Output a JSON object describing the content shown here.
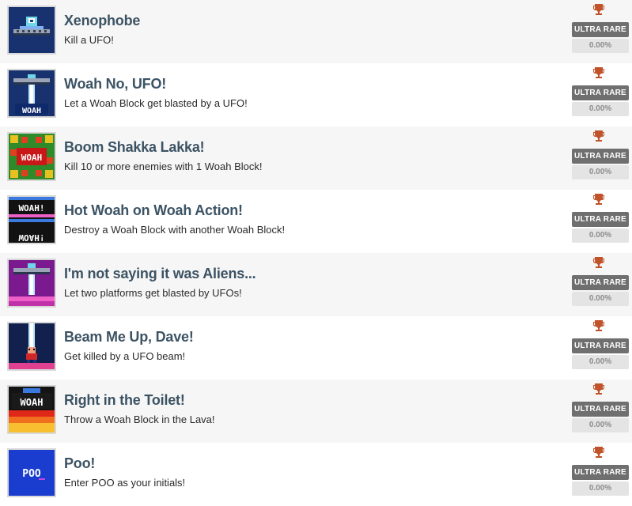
{
  "colors": {
    "title": "#3c5364",
    "badge_bg": "#6f6f6f",
    "percent_bg": "#e4e4e4",
    "trophy": "#c0532a"
  },
  "achievements": [
    {
      "title": "Xenophobe",
      "description": "Kill a UFO!",
      "rarity": "ULTRA RARE",
      "percent": "0.00%",
      "icon": "ufo-icon"
    },
    {
      "title": "Woah No, UFO!",
      "description": "Let a Woah Block get blasted by a UFO!",
      "rarity": "ULTRA RARE",
      "percent": "0.00%",
      "icon": "ufo-beam-woah-icon",
      "icon_text": "WOAH"
    },
    {
      "title": "Boom Shakka Lakka!",
      "description": "Kill 10 or more enemies with 1 Woah Block!",
      "rarity": "ULTRA RARE",
      "percent": "0.00%",
      "icon": "woah-block-enemies-icon",
      "icon_text": "WOAH"
    },
    {
      "title": "Hot Woah on Woah Action!",
      "description": "Destroy a Woah Block with another Woah Block!",
      "rarity": "ULTRA RARE",
      "percent": "0.00%",
      "icon": "woah-on-woah-icon",
      "icon_text": "WOAH!"
    },
    {
      "title": "I'm not saying it was Aliens...",
      "description": "Let two platforms get blasted by UFOs!",
      "rarity": "ULTRA RARE",
      "percent": "0.00%",
      "icon": "ufo-platform-icon"
    },
    {
      "title": "Beam Me Up, Dave!",
      "description": "Get killed by a UFO beam!",
      "rarity": "ULTRA RARE",
      "percent": "0.00%",
      "icon": "beam-me-up-icon"
    },
    {
      "title": "Right in the Toilet!",
      "description": "Throw a Woah Block in the Lava!",
      "rarity": "ULTRA RARE",
      "percent": "0.00%",
      "icon": "woah-lava-icon",
      "icon_text": "WOAH"
    },
    {
      "title": "Poo!",
      "description": "Enter POO as your initials!",
      "rarity": "ULTRA RARE",
      "percent": "0.00%",
      "icon": "poo-initials-icon",
      "icon_text": "POO"
    }
  ]
}
